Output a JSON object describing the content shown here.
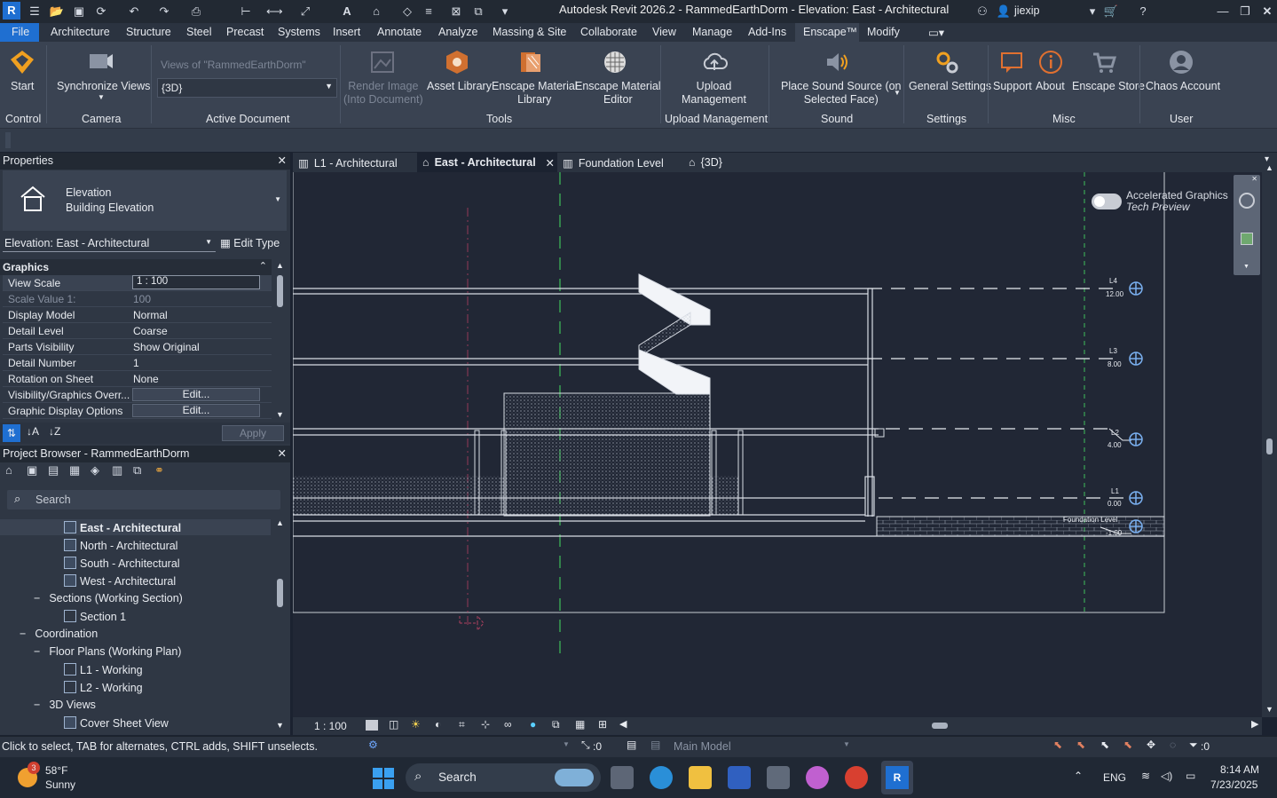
{
  "window": {
    "title": "Autodesk Revit 2026.2 - RammedEarthDorm - Elevation: East - Architectural",
    "user": "jiexip"
  },
  "menu": [
    "File",
    "Architecture",
    "Structure",
    "Steel",
    "Precast",
    "Systems",
    "Insert",
    "Annotate",
    "Analyze",
    "Massing & Site",
    "Collaborate",
    "View",
    "Manage",
    "Add-Ins",
    "Enscape™",
    "Modify"
  ],
  "ribbon": {
    "start": "Start",
    "sync_views": "Synchronize Views",
    "views_of": "Views of \"RammedEarthDorm\"",
    "view_select": "{3D}",
    "render_image": "Render Image",
    "render_image_sub": "(Into Document)",
    "asset_library": "Asset Library",
    "mat_library_1": "Enscape Material",
    "mat_library_2": "Library",
    "mat_editor_1": "Enscape Material",
    "mat_editor_2": "Editor",
    "upload_1": "Upload",
    "upload_2": "Management",
    "sound_1": "Place Sound Source (on",
    "sound_2": "Selected Face)",
    "general_settings": "General Settings",
    "support": "Support",
    "about": "About",
    "store": "Enscape Store",
    "chaos": "Chaos Account",
    "groups": {
      "control": "Control",
      "camera": "Camera",
      "active_doc": "Active Document",
      "tools": "Tools",
      "upload": "Upload Management",
      "sound": "Sound",
      "settings": "Settings",
      "misc": "Misc",
      "user": "User"
    }
  },
  "properties": {
    "title": "Properties",
    "type_line1": "Elevation",
    "type_line2": "Building Elevation",
    "instance": "Elevation: East - Architectural",
    "edit_type": "Edit Type",
    "section": "Graphics",
    "rows": [
      {
        "k": "View Scale",
        "v": "1 : 100"
      },
      {
        "k": "Scale Value    1:",
        "v": "100"
      },
      {
        "k": "Display Model",
        "v": "Normal"
      },
      {
        "k": "Detail Level",
        "v": "Coarse"
      },
      {
        "k": "Parts Visibility",
        "v": "Show Original"
      },
      {
        "k": "Detail Number",
        "v": "1"
      },
      {
        "k": "Rotation on Sheet",
        "v": "None"
      },
      {
        "k": "Visibility/Graphics Overr...",
        "v": "Edit..."
      },
      {
        "k": "Graphic Display Options",
        "v": "Edit..."
      }
    ],
    "apply": "Apply"
  },
  "browser": {
    "title": "Project Browser - RammedEarthDorm",
    "search_placeholder": "Search",
    "items": [
      {
        "label": "East - Architectural"
      },
      {
        "label": "North - Architectural"
      },
      {
        "label": "South - Architectural"
      },
      {
        "label": "West - Architectural"
      },
      {
        "label": "Sections (Working Section)"
      },
      {
        "label": "Section 1"
      },
      {
        "label": "Coordination"
      },
      {
        "label": "Floor Plans (Working Plan)"
      },
      {
        "label": "L1 - Working"
      },
      {
        "label": "L2 - Working"
      },
      {
        "label": "3D Views"
      },
      {
        "label": "Cover Sheet View"
      }
    ]
  },
  "tabs": [
    {
      "label": "L1 - Architectural"
    },
    {
      "label": "East - Architectural"
    },
    {
      "label": "Foundation Level"
    },
    {
      "label": "{3D}"
    }
  ],
  "view": {
    "toggle_line1": "Accelerated Graphics",
    "toggle_line2": "Tech Preview",
    "levels": [
      {
        "name": "L4",
        "elev": "12.00"
      },
      {
        "name": "L3",
        "elev": "8.00"
      },
      {
        "name": "L2",
        "elev": "4.00"
      },
      {
        "name": "L1",
        "elev": "0.00"
      },
      {
        "name": "Foundation Level",
        "elev": "-1.00"
      }
    ],
    "scale": "1 : 100"
  },
  "status": {
    "hint": "Click to select, TAB for alternates, CTRL adds, SHIFT unselects.",
    "worksets": ":0",
    "model": "Main Model",
    "filter": ":0"
  },
  "taskbar": {
    "weather_temp": "58°F",
    "weather_desc": "Sunny",
    "badge": "3",
    "search": "Search",
    "lang": "ENG",
    "time": "8:14 AM",
    "date": "7/23/2025"
  }
}
